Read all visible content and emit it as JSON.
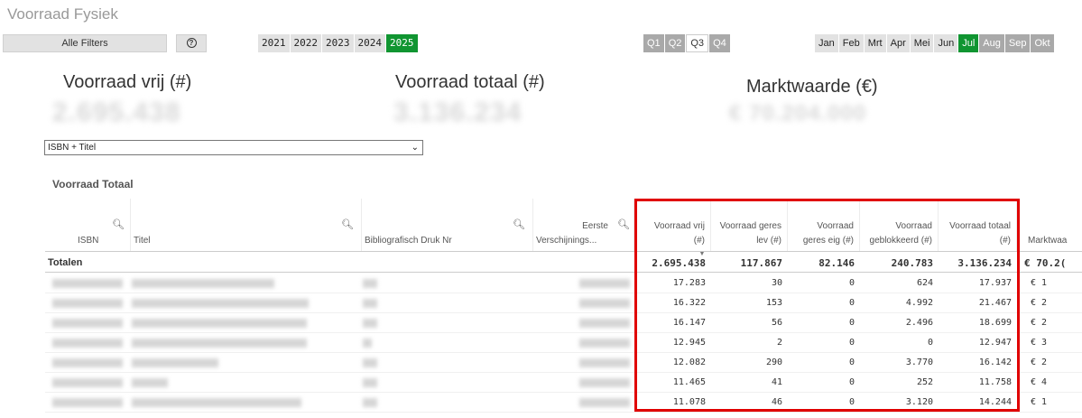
{
  "page": {
    "title": "Voorraad Fysiek"
  },
  "toolbar": {
    "filters_label": "Alle Filters",
    "help_glyph": "?"
  },
  "years": [
    "2021",
    "2022",
    "2023",
    "2024",
    "2025"
  ],
  "selected_year": "2025",
  "quarters": [
    "Q1",
    "Q2",
    "Q3",
    "Q4"
  ],
  "months": [
    "Jan",
    "Feb",
    "Mrt",
    "Apr",
    "Mei",
    "Jun",
    "Jul",
    "Aug",
    "Sep",
    "Okt"
  ],
  "selected_month": "Jul",
  "kpis": {
    "vrij_title": "Voorraad vrij (#)",
    "vrij_value": "2.695.438",
    "totaal_title": "Voorraad totaal (#)",
    "totaal_value": "3.136.234",
    "markt_title": "Marktwaarde (€)",
    "markt_value": "€ 70.204.000"
  },
  "dropdown": {
    "value": "ISBN + Titel"
  },
  "section": {
    "title": "Voorraad Totaal"
  },
  "table": {
    "headers": {
      "isbn": "ISBN",
      "titel": "Titel",
      "biblio": "Bibliografisch Druk Nr",
      "eerste_1": "Eerste",
      "eerste_2": "Verschijnings...",
      "vrij_1": "Voorraad vrij",
      "vrij_2": "(#)",
      "geres_lev_1": "Voorraad geres",
      "geres_lev_2": "lev (#)",
      "geres_eig_1": "Voorraad",
      "geres_eig_2": "geres eig (#)",
      "geblok_1": "Voorraad",
      "geblok_2": "geblokkeerd (#)",
      "totaal_1": "Voorraad totaal",
      "totaal_2": "(#)",
      "markt": "Marktwaa"
    },
    "totals": {
      "label": "Totalen",
      "vrij": "2.695.438",
      "geres_lev": "117.867",
      "geres_eig": "82.146",
      "geblok": "240.783",
      "totaal": "3.136.234",
      "markt": "€ 70.2("
    },
    "rows": [
      {
        "vrij": "17.283",
        "geres_lev": "30",
        "geres_eig": "0",
        "geblok": "624",
        "totaal": "17.937",
        "markt": "€ 1"
      },
      {
        "vrij": "16.322",
        "geres_lev": "153",
        "geres_eig": "0",
        "geblok": "4.992",
        "totaal": "21.467",
        "markt": "€ 2"
      },
      {
        "vrij": "16.147",
        "geres_lev": "56",
        "geres_eig": "0",
        "geblok": "2.496",
        "totaal": "18.699",
        "markt": "€ 2"
      },
      {
        "vrij": "12.945",
        "geres_lev": "2",
        "geres_eig": "0",
        "geblok": "0",
        "totaal": "12.947",
        "markt": "€ 3"
      },
      {
        "vrij": "12.082",
        "geres_lev": "290",
        "geres_eig": "0",
        "geblok": "3.770",
        "totaal": "16.142",
        "markt": "€ 2"
      },
      {
        "vrij": "11.465",
        "geres_lev": "41",
        "geres_eig": "0",
        "geblok": "252",
        "totaal": "11.758",
        "markt": "€ 4"
      },
      {
        "vrij": "11.078",
        "geres_lev": "46",
        "geres_eig": "0",
        "geblok": "3.120",
        "totaal": "14.244",
        "markt": "€ 1"
      }
    ]
  },
  "colors": {
    "accent_green": "#109531",
    "highlight_red": "#e00000"
  }
}
